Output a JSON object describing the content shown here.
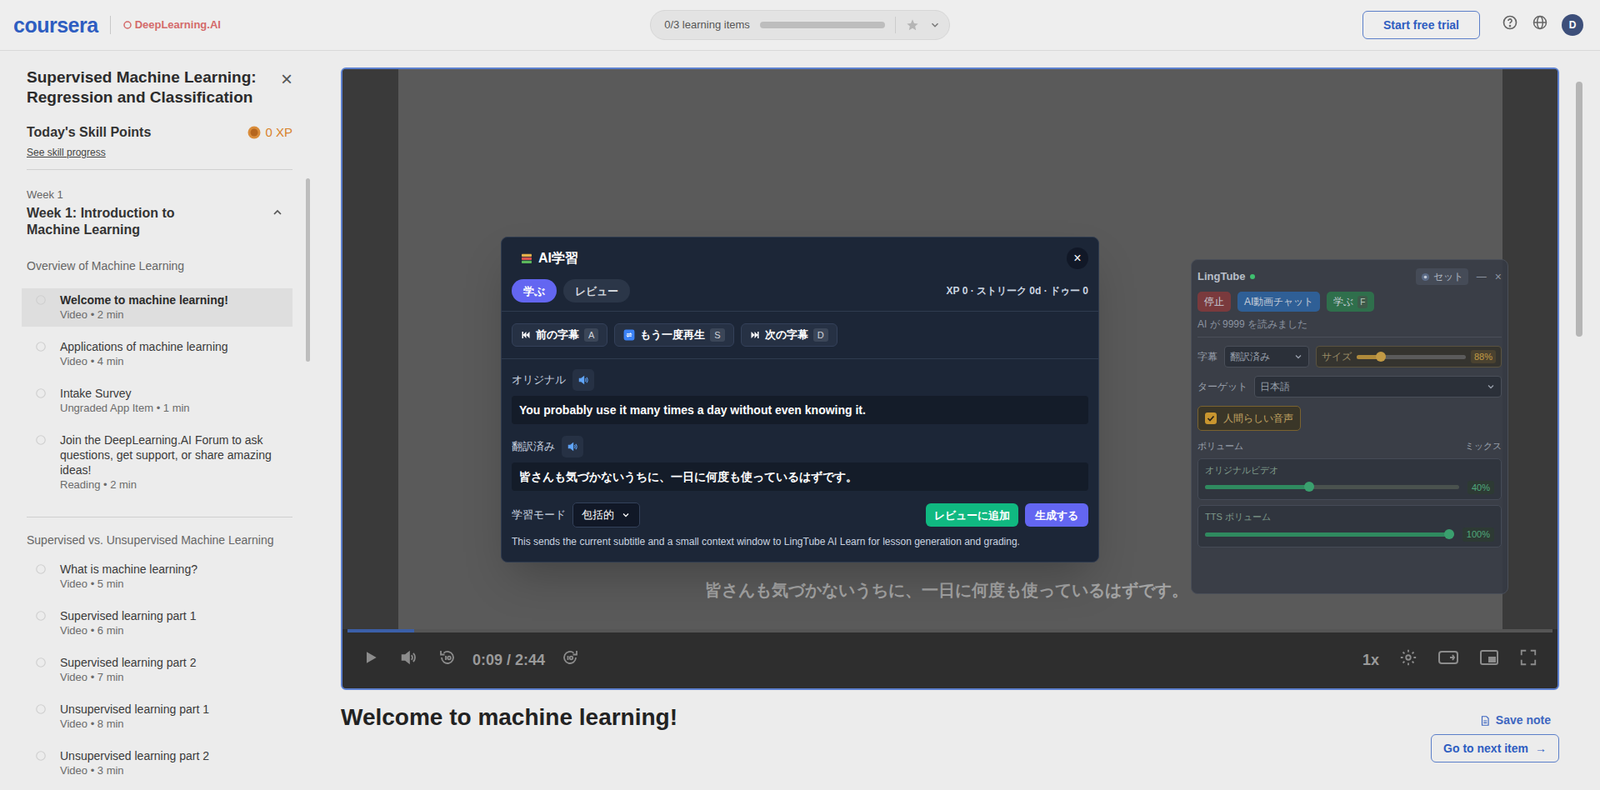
{
  "topbar": {
    "logo": "coursera",
    "partner": "DeepLearning.AI",
    "progress_label": "0/3 learning items",
    "progress_level": 0,
    "trial_button": "Start free trial",
    "avatar": "D"
  },
  "sidebar": {
    "course_title": "Supervised Machine Learning: Regression and Classification",
    "close": "×",
    "skill_title": "Today's Skill Points",
    "xp": "0 XP",
    "skill_link": "See skill progress",
    "week_label": "Week 1",
    "week_title": "Week 1: Introduction to Machine Learning",
    "week_expanded": true,
    "sections": [
      {
        "title": "Overview of Machine Learning",
        "items": [
          {
            "title": "Welcome to machine learning!",
            "meta": "Video • 2 min",
            "selected": true
          },
          {
            "title": "Applications of machine learning",
            "meta": "Video • 4 min",
            "selected": false
          },
          {
            "title": "Intake Survey",
            "meta": "Ungraded App Item • 1 min",
            "selected": false
          },
          {
            "title": "Join the DeepLearning.AI Forum to ask questions, get support, or share amazing ideas!",
            "meta": "Reading • 2 min",
            "selected": false
          }
        ]
      },
      {
        "title": "Supervised vs. Unsupervised Machine Learning",
        "items": [
          {
            "title": "What is machine learning?",
            "meta": "Video • 5 min",
            "selected": false
          },
          {
            "title": "Supervised learning part 1",
            "meta": "Video • 6 min",
            "selected": false
          },
          {
            "title": "Supervised learning part 2",
            "meta": "Video • 7 min",
            "selected": false
          },
          {
            "title": "Unsupervised learning part 1",
            "meta": "Video • 8 min",
            "selected": false
          },
          {
            "title": "Unsupervised learning part 2",
            "meta": "Video • 3 min",
            "selected": false
          }
        ]
      }
    ]
  },
  "video": {
    "subtitle": "皆さんも気づかないうちに、一日に何度も使っているはずです。",
    "progress_level": 0.055,
    "time": "0:09 / 2:44",
    "speed": "1x"
  },
  "page": {
    "heading": "Welcome to machine learning!",
    "save_note": "Save note",
    "next_item": "Go to next item",
    "next_arrow": "→"
  },
  "learn_dialog": {
    "title": "AI学習",
    "close": "×",
    "tabs": [
      {
        "label": "学ぶ",
        "selected": true
      },
      {
        "label": "レビュー",
        "selected": false
      }
    ],
    "stats": "XP 0 · ストリーク 0d · ドゥー 0",
    "nav_buttons": [
      {
        "label": "前の字幕",
        "key": "A"
      },
      {
        "label": "もう一度再生",
        "key": "S"
      },
      {
        "label": "次の字幕",
        "key": "D"
      }
    ],
    "fields": [
      {
        "label": "オリジナル",
        "text": "You probably use it many times a day without even knowing it."
      },
      {
        "label": "翻訳済み",
        "text": "皆さんも気づかないうちに、一日に何度も使っているはずです。"
      }
    ],
    "mode_label": "学習モード",
    "mode_value": "包括的",
    "add_review": "レビューに追加",
    "generate": "生成する",
    "note": "This sends the current subtitle and a small context window to LingTube AI Learn for lesson generation and grading."
  },
  "lingtube": {
    "title": "LingTube",
    "online": true,
    "set_button": "セット",
    "minimize": "—",
    "close": "×",
    "actions": [
      {
        "label": "停止",
        "color": "#7a3a3d"
      },
      {
        "label": "AI動画チャット",
        "color": "#2f5f96"
      },
      {
        "label": "学ぶ",
        "key": "F",
        "color": "#2f6f4c"
      }
    ],
    "status": "AI が 9999 を読みました",
    "subtitle_label": "字幕",
    "subtitle_value": "翻訳済み",
    "size": {
      "label": "サイズ",
      "level": 0.22,
      "reading": "88%"
    },
    "target_label": "ターゲット",
    "target_value": "日本語",
    "human_voice": {
      "label": "人間らしい音声",
      "checked": true
    },
    "volume_label": "ボリューム",
    "mix_label": "ミックス",
    "volumes": [
      {
        "label": "オリジナルビデオ",
        "level": 0.41,
        "reading": "40%"
      },
      {
        "label": "TTS ボリューム",
        "level": 0.98,
        "reading": "100%"
      }
    ]
  }
}
